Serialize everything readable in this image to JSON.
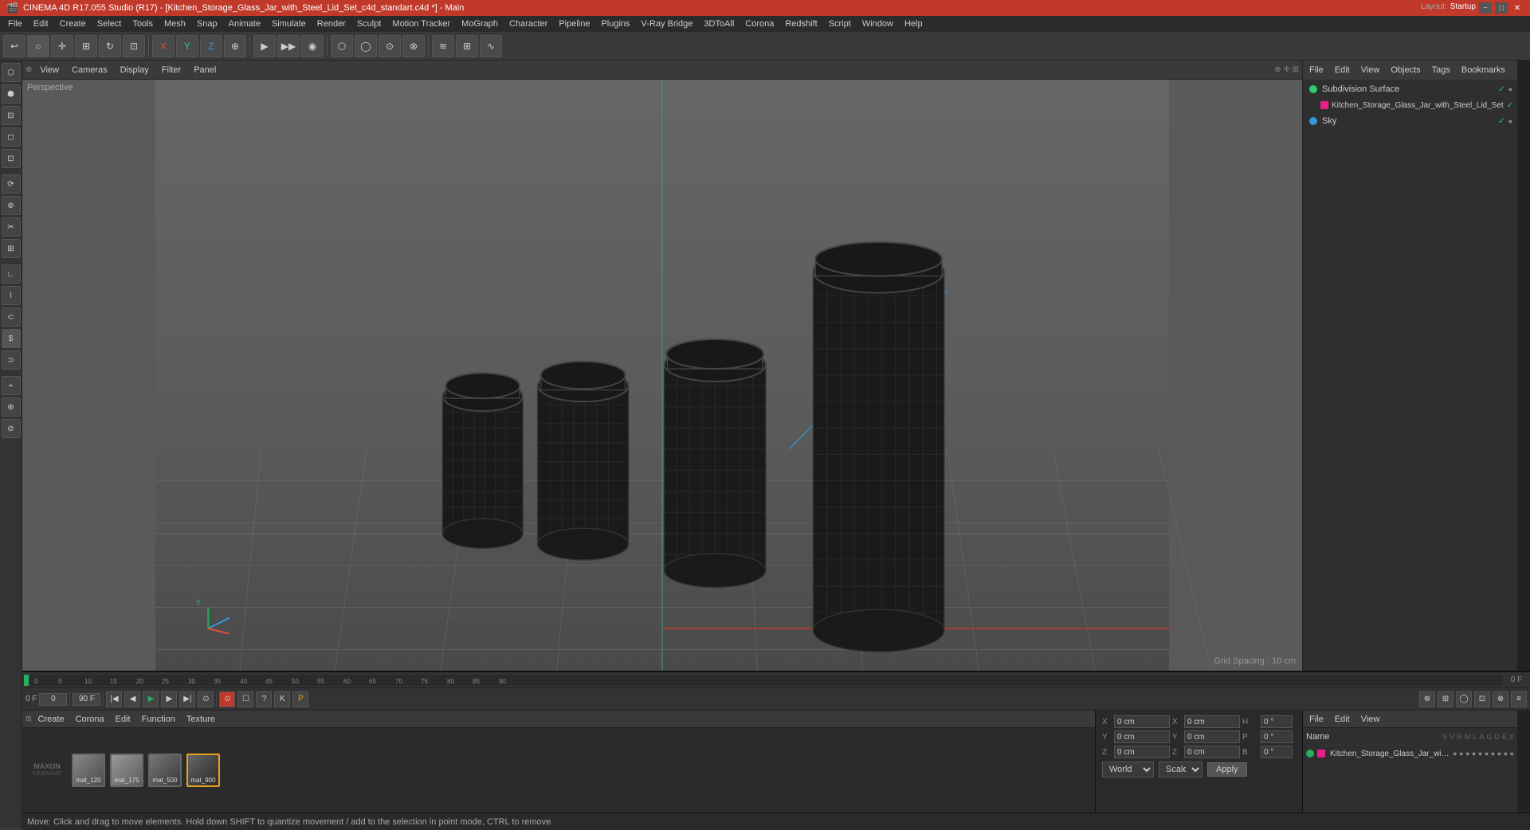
{
  "window": {
    "title": "CINEMA 4D R17.055 Studio (R17) - [Kitchen_Storage_Glass_Jar_with_Steel_Lid_Set_c4d_standart.c4d *] - Main",
    "layout_label": "Layout:",
    "layout_value": "Startup"
  },
  "title_buttons": {
    "minimize": "−",
    "maximize": "□",
    "close": "✕"
  },
  "menu": {
    "items": [
      "File",
      "Edit",
      "Create",
      "Select",
      "Tools",
      "Mesh",
      "Snap",
      "Animate",
      "Simulate",
      "Render",
      "Sculpt",
      "Motion Tracker",
      "MoGraph",
      "Character",
      "Pipeline",
      "Plugins",
      "V-Ray Bridge",
      "3DToAll",
      "Corona",
      "Redshift",
      "Script",
      "Window",
      "Help"
    ]
  },
  "viewport": {
    "perspective_label": "Perspective",
    "grid_spacing": "Grid Spacing : 10 cm",
    "view_menu": [
      "View",
      "Cameras",
      "Display",
      "Filter",
      "Panel"
    ],
    "nav_icons": [
      "◈",
      "✛",
      "⊕"
    ]
  },
  "right_panel": {
    "header_tabs": [
      "File",
      "Edit",
      "View",
      "Objects",
      "Tags",
      "Bookmarks"
    ],
    "objects": [
      {
        "name": "Subdivision Surface",
        "icon": "subdivision",
        "color": "green"
      },
      {
        "name": "Kitchen_Storage_Glass_Jar_with_Steel_Lid_Set",
        "icon": "mesh",
        "color": "pink",
        "indent": 16
      },
      {
        "name": "Sky",
        "icon": "sky",
        "color": "sky"
      }
    ]
  },
  "bottom_timeline": {
    "current_frame": "0 F",
    "frame_input": "0",
    "start_frame": "0 F",
    "end_frame": "90 F",
    "frame_marks": [
      "0",
      "5",
      "10",
      "15",
      "20",
      "25",
      "30",
      "35",
      "40",
      "45",
      "50",
      "55",
      "60",
      "65",
      "70",
      "75",
      "80",
      "85",
      "90"
    ],
    "right_mark": "0 F"
  },
  "material_editor": {
    "toolbar": [
      "Create",
      "Corona",
      "Edit",
      "Function",
      "Texture"
    ],
    "materials": [
      {
        "name": "mat_120",
        "label": "mat_120",
        "selected": false
      },
      {
        "name": "mat_175",
        "label": "mat_175",
        "selected": false
      },
      {
        "name": "mat_500",
        "label": "mat_500",
        "selected": false
      },
      {
        "name": "mat_900",
        "label": "mat_900",
        "selected": true
      }
    ]
  },
  "attr_panel": {
    "toolbar": [
      "File",
      "Edit",
      "View"
    ],
    "name_label": "Name",
    "col_headers": [
      "S",
      "V",
      "R",
      "M",
      "L",
      "A",
      "G",
      "D",
      "E",
      "X"
    ],
    "object_name": "Kitchen_Storage_Glass_Jar_with_Steel_Lid_Set"
  },
  "coordinates": {
    "rows": [
      {
        "axis": "X",
        "pos": "0 cm",
        "axis2": "X",
        "rot": "0 cm",
        "deg": "H",
        "deg_val": "0 °"
      },
      {
        "axis": "Y",
        "pos": "0 cm",
        "axis2": "Y",
        "rot": "0 cm",
        "deg": "P",
        "deg_val": "0 °"
      },
      {
        "axis": "Z",
        "pos": "0 cm",
        "axis2": "Z",
        "rot": "0 cm",
        "deg": "B",
        "deg_val": "0 °"
      }
    ],
    "world_label": "World",
    "scale_label": "Scale",
    "apply_label": "Apply"
  },
  "status_bar": {
    "text": "Move: Click and drag to move elements. Hold down SHIFT to quantize movement / add to the selection in point mode, CTRL to remove."
  },
  "maxon_logo": "MAXON\nCINEMA4D"
}
